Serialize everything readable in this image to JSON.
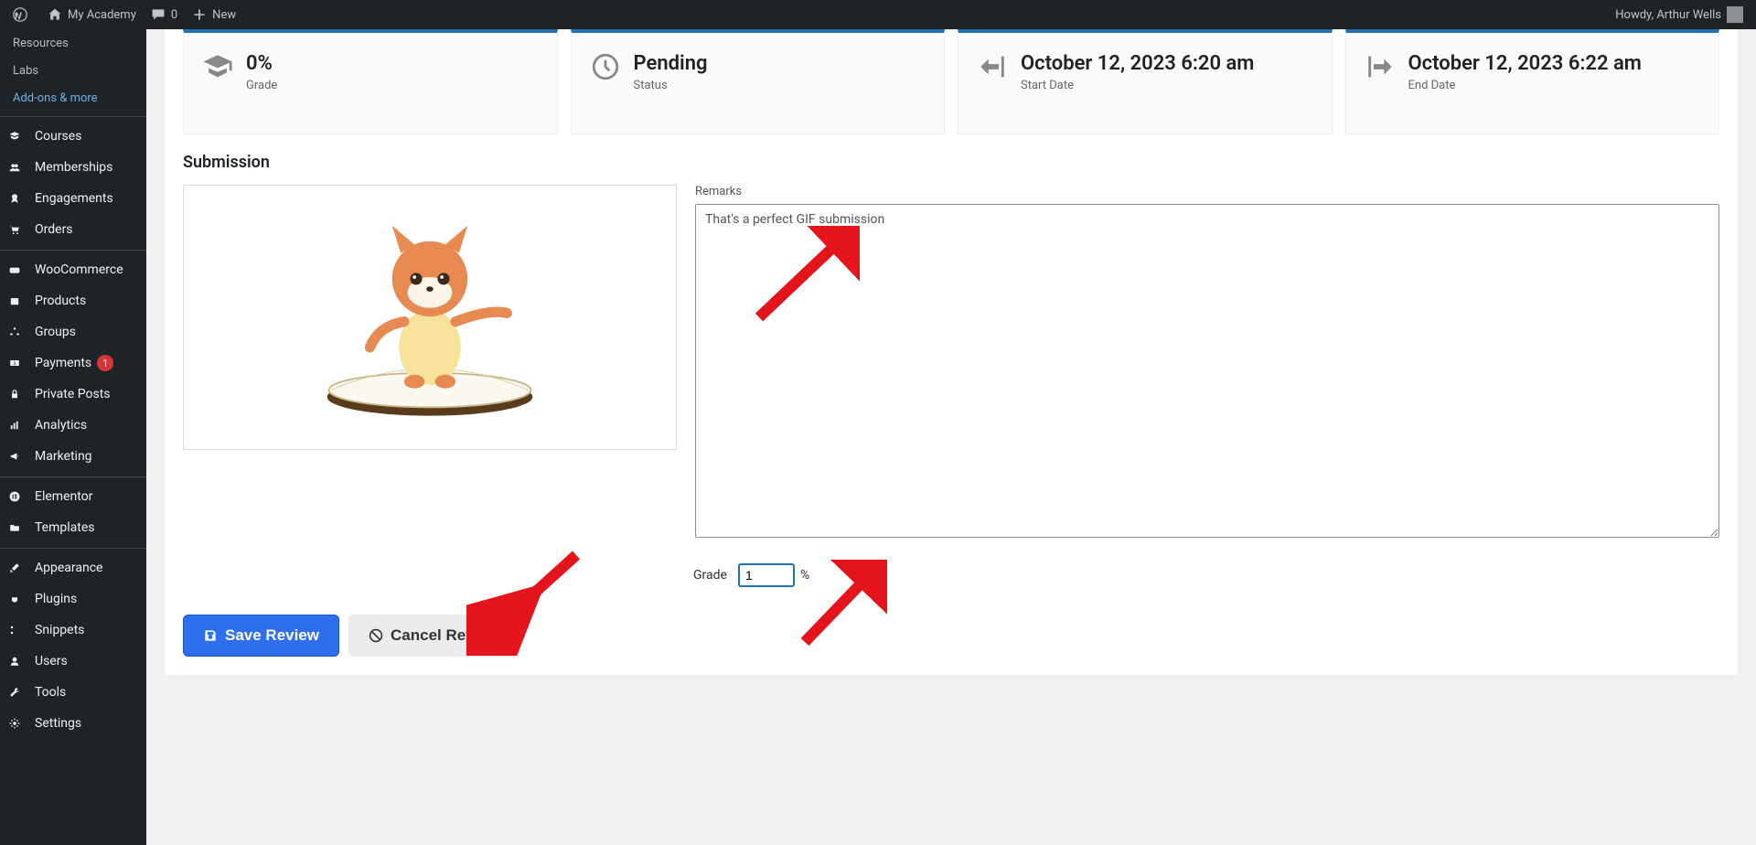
{
  "adminbar": {
    "site_name": "My Academy",
    "comments_count": "0",
    "new_label": "New",
    "howdy_prefix": "Howdy,",
    "user_name": "Arthur Wells"
  },
  "sidebar": {
    "sub_items": [
      {
        "label": "Resources",
        "active": false
      },
      {
        "label": "Labs",
        "active": false
      },
      {
        "label": "Add-ons & more",
        "active": true
      }
    ],
    "items": [
      {
        "label": "Courses",
        "icon": "courses"
      },
      {
        "label": "Memberships",
        "icon": "users"
      },
      {
        "label": "Engagements",
        "icon": "badge"
      },
      {
        "label": "Orders",
        "icon": "cart"
      },
      {
        "label": "__sep"
      },
      {
        "label": "WooCommerce",
        "icon": "woo"
      },
      {
        "label": "Products",
        "icon": "box"
      },
      {
        "label": "Groups",
        "icon": "net"
      },
      {
        "label": "Payments",
        "icon": "money",
        "badge": "1"
      },
      {
        "label": "Private Posts",
        "icon": "lock"
      },
      {
        "label": "Analytics",
        "icon": "chart"
      },
      {
        "label": "Marketing",
        "icon": "megaphone"
      },
      {
        "label": "__sep"
      },
      {
        "label": "Elementor",
        "icon": "elementor"
      },
      {
        "label": "Templates",
        "icon": "folder"
      },
      {
        "label": "__sep"
      },
      {
        "label": "Appearance",
        "icon": "brush"
      },
      {
        "label": "Plugins",
        "icon": "plug"
      },
      {
        "label": "Snippets",
        "icon": "scissors"
      },
      {
        "label": "Users",
        "icon": "user"
      },
      {
        "label": "Tools",
        "icon": "wrench"
      },
      {
        "label": "Settings",
        "icon": "gear"
      }
    ]
  },
  "stats": {
    "grade": {
      "value": "0%",
      "label": "Grade"
    },
    "status": {
      "value": "Pending",
      "label": "Status"
    },
    "start": {
      "value": "October 12, 2023 6:20 am",
      "label": "Start Date"
    },
    "end": {
      "value": "October 12, 2023 6:22 am",
      "label": "End Date"
    }
  },
  "submission": {
    "title": "Submission",
    "remarks_label": "Remarks",
    "remarks_value": "That's a perfect GIF submission",
    "grade_label": "Grade",
    "grade_value": "1",
    "grade_unit": "%"
  },
  "actions": {
    "save": "Save Review",
    "cancel": "Cancel Review"
  }
}
